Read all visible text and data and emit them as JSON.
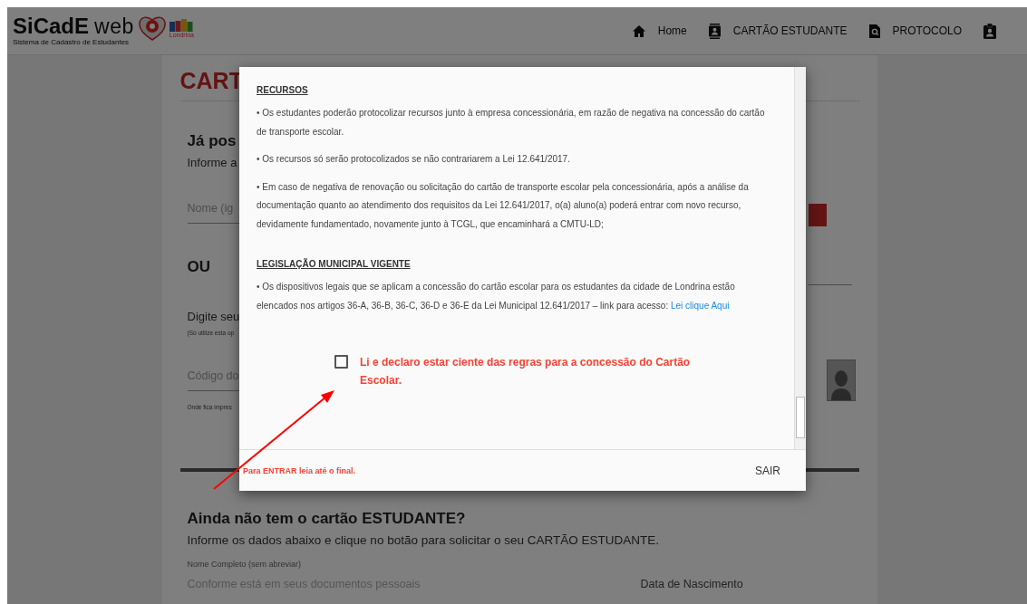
{
  "header": {
    "brand": "SiCadE",
    "brand_suffix": "web",
    "subtitle": "Sistema de Cadastro de Estudantes",
    "partner": "Londrina",
    "nav": [
      {
        "kind": "home",
        "label": "Home"
      },
      {
        "kind": "contact",
        "label": "CARTÃO ESTUDANTE"
      },
      {
        "kind": "search-doc",
        "label": "PROTOCOLO"
      },
      {
        "kind": "badge"
      }
    ]
  },
  "background": {
    "title": "CART",
    "login_heading": "Já pos",
    "login_hint": "Informe a",
    "name_placeholder": "Nome (ig",
    "or": "OU",
    "code_label": "Digite seu",
    "code_note": "(Só utilize esta op",
    "code_placeholder": "Código do",
    "code_where": "Onde fica impres",
    "register_heading": "Ainda não tem o cartão ESTUDANTE?",
    "register_hint": "Informe os dados abaixo e clique no botão para solicitar o seu CARTÃO ESTUDANTE.",
    "full_name_label": "Nome Completo (sem abreviar)",
    "full_name_placeholder": "Conforme está em seus documentos pessoais",
    "birth_placeholder": "Data de Nascimento"
  },
  "modal": {
    "sections": [
      {
        "heading": "RECURSOS",
        "paragraphs": [
          {
            "text": "• Os estudantes poderão protocolizar recursos junto à empresa concessionária, em razão de negativa na concessão do cartão de transporte escolar."
          },
          {
            "text": "• Os recursos só serão protocolizados se não contrariarem a Lei 12.641/2017."
          },
          {
            "text": "• Em caso de negativa de renovação ou solicitação do cartão de transporte escolar pela concessionária, após a análise da documentação quanto ao atendimento dos requisitos da Lei 12.641/2017, o(a) aluno(a) poderá entrar com novo recurso, devidamente fundamentado, novamente junto à TCGL, que encaminhará a CMTU-LD;"
          }
        ]
      },
      {
        "heading": "LEGISLAÇÃO MUNICIPAL VIGENTE",
        "paragraphs": [
          {
            "text": "• Os dispositivos legais que se aplicam a concessão do cartão escolar para os estudantes da cidade de Londrina estão elencados nos artigos 36-A, 36-B, 36-C, 36-D e 36-E da Lei Municipal 12.641/2017 – link para acesso:",
            "link": "Lei clique Aqui"
          }
        ]
      }
    ],
    "agreement": {
      "label": "Li e declaro estar ciente das regras para a concessão do Cartão Escolar.",
      "checked": false
    },
    "warning": "Para ENTRAR leia até o final.",
    "button": "SAIR"
  }
}
